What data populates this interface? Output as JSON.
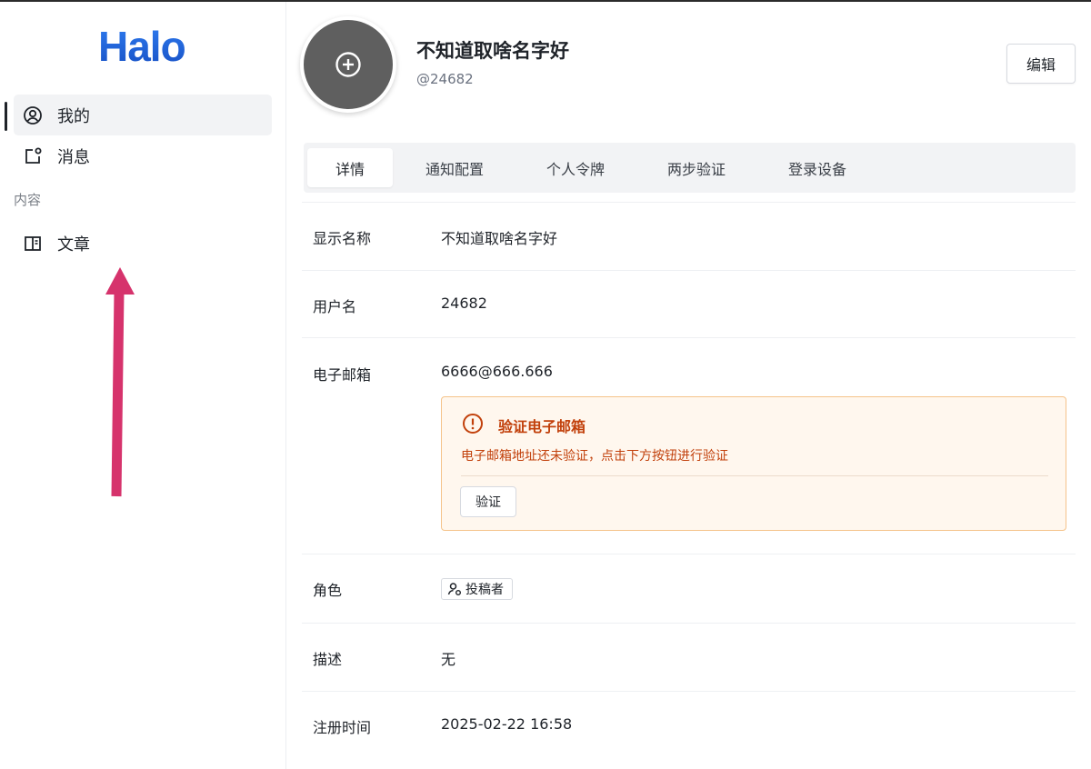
{
  "app": {
    "logo_text": "Halo"
  },
  "sidebar": {
    "items": [
      {
        "label": "我的",
        "icon": "user-circle-icon",
        "active": true
      },
      {
        "label": "消息",
        "icon": "notification-icon",
        "active": false
      }
    ],
    "sections": [
      {
        "label": "内容",
        "items": [
          {
            "label": "文章",
            "icon": "book-icon"
          }
        ]
      }
    ]
  },
  "profile": {
    "display_name": "不知道取啥名字好",
    "handle": "@24682",
    "edit_label": "编辑"
  },
  "tabs": [
    {
      "label": "详情",
      "active": true
    },
    {
      "label": "通知配置",
      "active": false
    },
    {
      "label": "个人令牌",
      "active": false
    },
    {
      "label": "两步验证",
      "active": false
    },
    {
      "label": "登录设备",
      "active": false
    }
  ],
  "details": {
    "display_name": {
      "label": "显示名称",
      "value": "不知道取啥名字好"
    },
    "username": {
      "label": "用户名",
      "value": "24682"
    },
    "email": {
      "label": "电子邮箱",
      "value": "6666@666.666"
    },
    "email_alert": {
      "title": "验证电子邮箱",
      "description": "电子邮箱地址还未验证，点击下方按钮进行验证",
      "button_label": "验证"
    },
    "role": {
      "label": "角色",
      "value": "投稿者"
    },
    "description": {
      "label": "描述",
      "value": "无"
    },
    "registered": {
      "label": "注册时间",
      "value": "2025-02-22 16:58"
    }
  },
  "colors": {
    "brand": "#1e63d6",
    "annotation_arrow": "#d6336c",
    "warning_text": "#c2410c",
    "warning_border": "#f5c38a",
    "warning_bg": "#fff7ee"
  }
}
